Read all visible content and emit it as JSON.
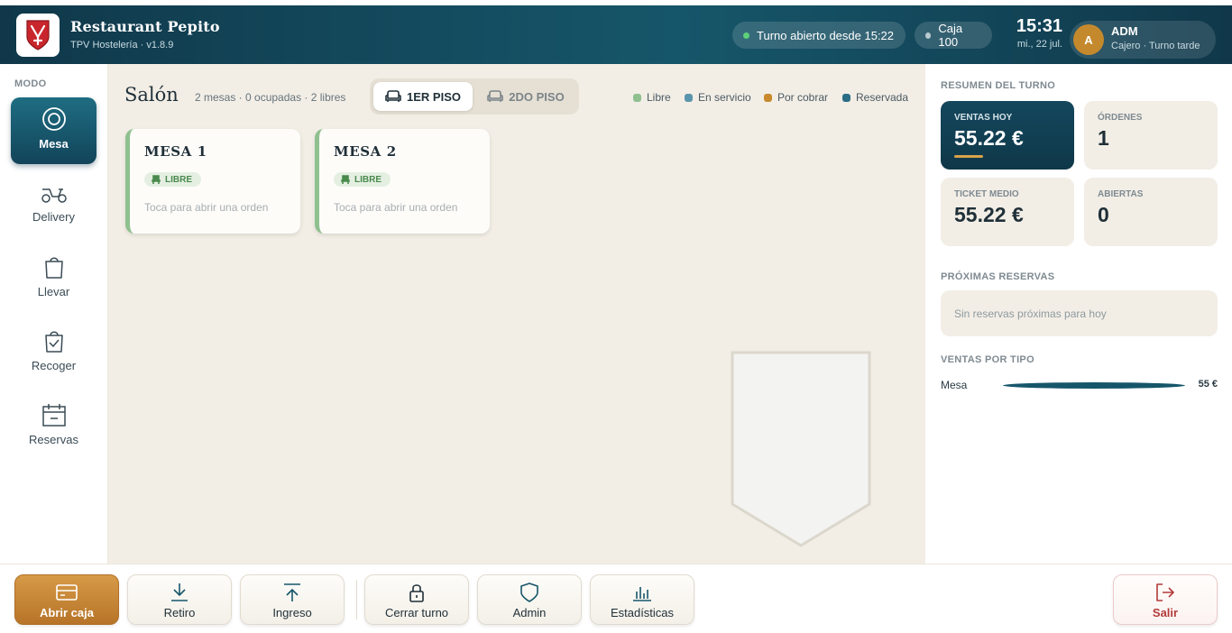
{
  "header": {
    "title": "Restaurant Pepito",
    "subtitle": "TPV Hostelería · v1.8.9",
    "shift_pill": "Turno abierto desde 15:22",
    "cash_pill": "Caja 100",
    "time": "15:31",
    "date": "mi., 22 jul.",
    "user_initial": "A",
    "user_name": "ADM",
    "user_role": "Cajero · Turno tarde"
  },
  "sidebar": {
    "section_label": "MODO",
    "items": [
      {
        "label": "Mesa",
        "icon": "target-icon",
        "active": true
      },
      {
        "label": "Delivery",
        "icon": "scooter-icon",
        "active": false
      },
      {
        "label": "Llevar",
        "icon": "bag-icon",
        "active": false
      },
      {
        "label": "Recoger",
        "icon": "bag-check-icon",
        "active": false
      },
      {
        "label": "Reservas",
        "icon": "calendar-icon",
        "active": false
      }
    ]
  },
  "main": {
    "title": "Salón",
    "summary": "2 mesas · 0 ocupadas · 2 libres",
    "floors": [
      {
        "label": "1ER PISO",
        "active": true
      },
      {
        "label": "2DO PISO",
        "active": false
      }
    ],
    "legend": [
      {
        "label": "Libre",
        "color": "#8fc08f"
      },
      {
        "label": "En servicio",
        "color": "#5b95ad"
      },
      {
        "label": "Por cobrar",
        "color": "#c88a2d"
      },
      {
        "label": "Reservada",
        "color": "#2c6d86"
      }
    ],
    "tables": [
      {
        "name": "MESA 1",
        "status": "LIBRE",
        "hint": "Toca para abrir una orden"
      },
      {
        "name": "MESA 2",
        "status": "LIBRE",
        "hint": "Toca para abrir una orden"
      }
    ]
  },
  "summary": {
    "title": "RESUMEN DEL TURNO",
    "stats": [
      {
        "label": "VENTAS HOY",
        "value": "55.22 €"
      },
      {
        "label": "ÓRDENES",
        "value": "1"
      },
      {
        "label": "TICKET MEDIO",
        "value": "55.22 €"
      },
      {
        "label": "ABIERTAS",
        "value": "0"
      }
    ],
    "reservations_title": "PRÓXIMAS RESERVAS",
    "reservations_empty": "Sin reservas próximas para hoy",
    "sales_type_title": "VENTAS POR TIPO",
    "sales_by_type": [
      {
        "label": "Mesa",
        "value": "55 €",
        "fraction": 1.0
      }
    ]
  },
  "actions": {
    "abrir_caja": "Abrir caja",
    "retiro": "Retiro",
    "ingreso": "Ingreso",
    "cerrar_turno": "Cerrar turno",
    "admin": "Admin",
    "estadisticas": "Estadísticas",
    "salir": "Salir"
  },
  "colors": {
    "header": "#10384a",
    "accent": "#16566a",
    "gold": "#c5892d",
    "free": "#8fc08f"
  }
}
